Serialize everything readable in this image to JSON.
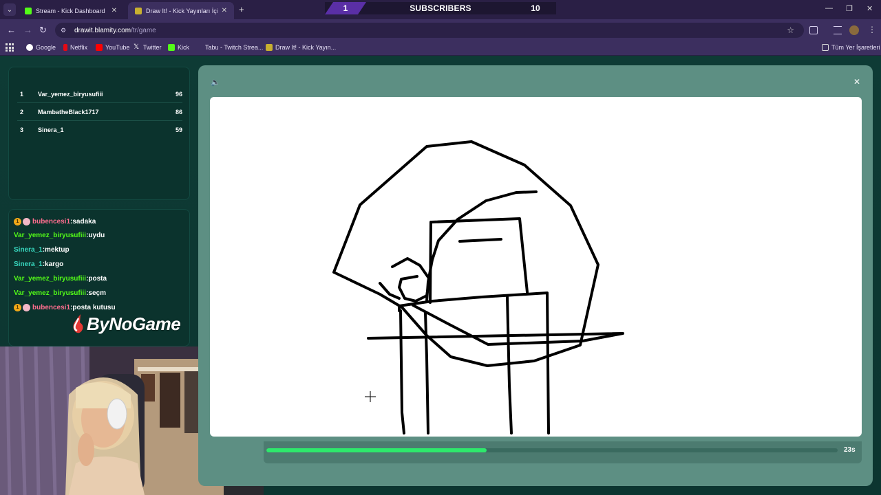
{
  "browser": {
    "tabs": [
      {
        "title": "Stream - Kick Dashboard"
      },
      {
        "title": "Draw It! - Kick Yayınları İçin Çizi"
      }
    ],
    "url_host": "drawit.blamity.com",
    "url_path": "/tr/game",
    "bookmarks": [
      "Google",
      "Netflix",
      "YouTube",
      "Twitter",
      "Kick",
      "Tabu - Twitch Strea...",
      "Draw It! - Kick Yayın..."
    ],
    "all_bookmarks": "Tüm Yer İşaretleri"
  },
  "overlay": {
    "left_count": "1",
    "title": "SUBSCRIBERS",
    "right_count": "10"
  },
  "leaderboard": [
    {
      "rank": "1",
      "name": "Var_yemez_biryusufiii",
      "score": "96"
    },
    {
      "rank": "2",
      "name": "MambatheBlack1717",
      "score": "86"
    },
    {
      "rank": "3",
      "name": "Sinera_1",
      "score": "59"
    }
  ],
  "chat": [
    {
      "user": "bubencesi1",
      "text": "sadaka",
      "color": "pink",
      "badges": true
    },
    {
      "user": "Var_yemez_biryusufiii",
      "text": "uydu",
      "color": "green",
      "badges": false
    },
    {
      "user": "Sinera_1",
      "text": "mektup",
      "color": "teal",
      "badges": false
    },
    {
      "user": "Sinera_1",
      "text": "kargo",
      "color": "teal",
      "badges": false
    },
    {
      "user": "Var_yemez_biryusufiii",
      "text": "posta",
      "color": "green",
      "badges": false
    },
    {
      "user": "Var_yemez_biryusufiii",
      "text": "seçm",
      "color": "green",
      "badges": false
    },
    {
      "user": "bubencesi1",
      "text": "posta kutusu",
      "color": "pink",
      "badges": true
    }
  ],
  "logo_text": "ByNoGame",
  "game": {
    "timer_progress": 0.386,
    "time_left": "23s"
  },
  "colors": {
    "progress": "#2ee86c",
    "kick_green": "#53fc18"
  }
}
